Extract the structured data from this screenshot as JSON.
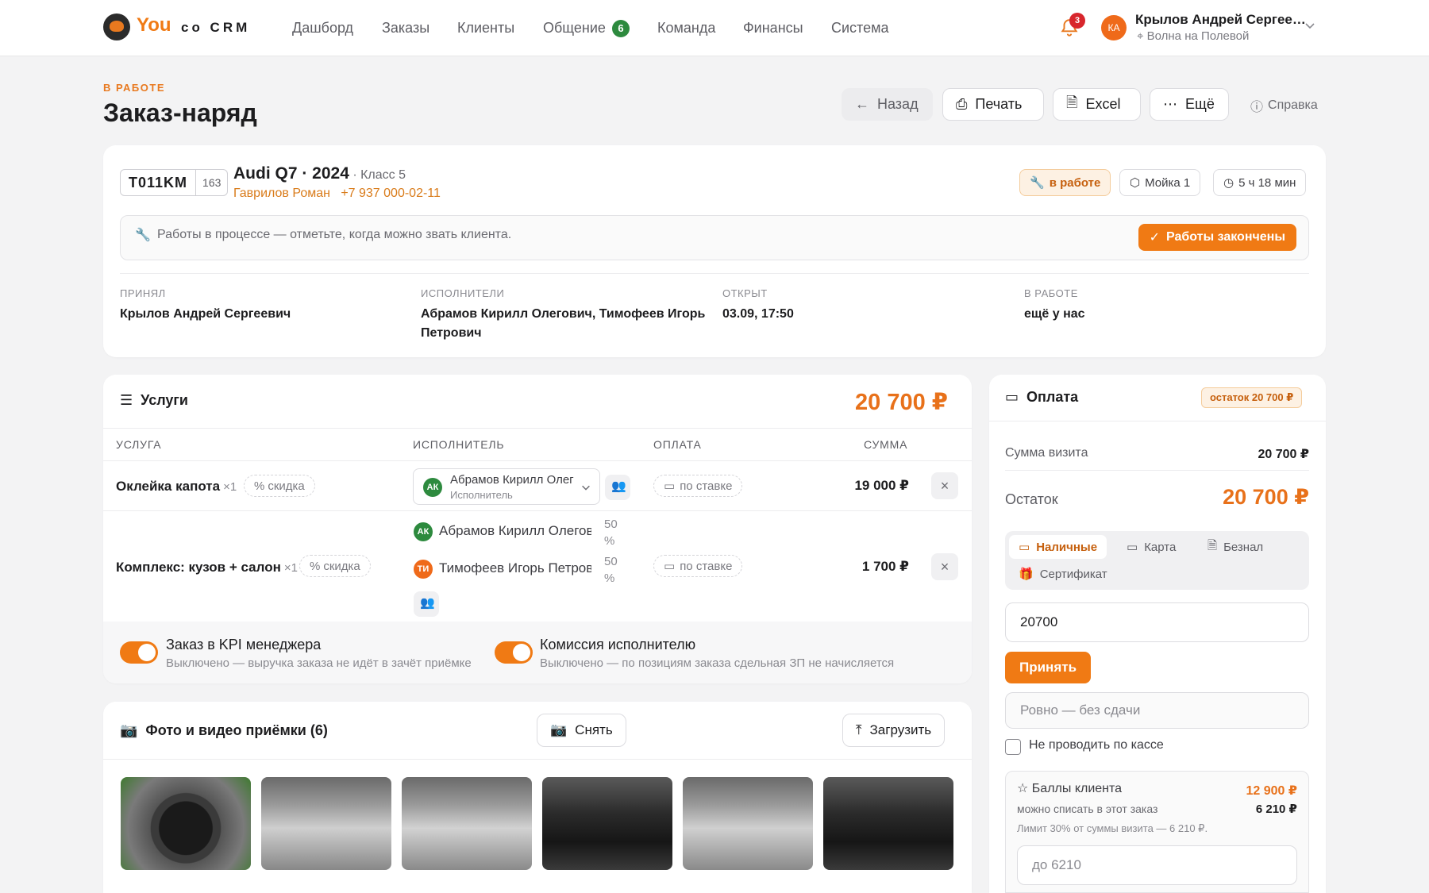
{
  "nav": {
    "logo_you": "You",
    "logo_crm": "co CRM",
    "items": [
      "Дашборд",
      "Заказы",
      "Клиенты",
      "Общение",
      "Команда",
      "Финансы",
      "Система"
    ],
    "chat_badge": "6",
    "notifications_count": "3",
    "user": {
      "initials": "КА",
      "name": "Крылов Андрей Сергее…",
      "location": "Волна на Полевой"
    }
  },
  "header": {
    "status": "В РАБОТЕ",
    "title": "Заказ-наряд",
    "buttons": {
      "back": "Назад",
      "print": "Печать",
      "excel": "Excel",
      "more": "Ещё"
    },
    "help": "Справка"
  },
  "vehicle": {
    "plate": "T011KM",
    "region": "163",
    "title": "Audi Q7 · 2024",
    "class": " · Класс 5",
    "owner": "Гаврилов Роман",
    "phone": "+7 937 000-02-11",
    "pills": {
      "status": "в работе",
      "wash": "Мойка 1",
      "time": "5 ч 18 мин"
    },
    "notice": "Работы в процессе — отметьте, когда можно звать клиента.",
    "done_button": "Работы закончены"
  },
  "meta": [
    {
      "label": "ПРИНЯЛ",
      "value": "Крылов Андрей Сергеевич"
    },
    {
      "label": "ИСПОЛНИТЕЛИ",
      "value": "Абрамов Кирилл Олегович, Тимофеев Игорь Петрович"
    },
    {
      "label": "ОТКРЫТ",
      "value": "03.09, 17:50"
    },
    {
      "label": "В РАБОТЕ",
      "value": "ещё у нас"
    }
  ],
  "services": {
    "title": "Услуги",
    "total": "20 700 ₽",
    "columns": [
      "УСЛУГА",
      "ИСПОЛНИТЕЛЬ",
      "ОПЛАТА",
      "СУММА"
    ],
    "discount_label": "скидка",
    "rate_label": "по ставке",
    "rows": [
      {
        "name": "Оклейка капота",
        "qty": "×1",
        "executor": {
          "initials": "АК",
          "name": "Абрамов Кирилл Олег",
          "role": "Исполнитель"
        },
        "amount": "19 000 ₽"
      },
      {
        "name": "Комплекс: кузов + салон",
        "qty": "×1",
        "executors": [
          {
            "initials": "АК",
            "name": "Абрамов Кирилл Олегови",
            "pct": "50",
            "pct_unit": "%"
          },
          {
            "initials": "ТИ",
            "name": "Тимофеев Игорь Петрови",
            "pct": "50",
            "pct_unit": "%"
          }
        ],
        "amount": "1 700 ₽"
      }
    ],
    "toggles": [
      {
        "title": "Заказ в KPI менеджера",
        "sub": "Выключено — выручка заказа не идёт в зачёт приёмке"
      },
      {
        "title": "Комиссия исполнителю",
        "sub": "Выключено — по позициям заказа сдельная ЗП не начисляется"
      }
    ]
  },
  "photos": {
    "title": "Фото и видео приёмки (6)",
    "shoot": "Снять",
    "upload": "Загрузить"
  },
  "payment": {
    "title": "Оплата",
    "rest_badge": "остаток 20 700 ₽",
    "visit_label": "Сумма визита",
    "visit_value": "20 700 ₽",
    "rest_label": "Остаток",
    "rest_value": "20 700 ₽",
    "tabs": [
      "Наличные",
      "Карта",
      "Безнал",
      "Сертификат"
    ],
    "amount_value": "20700",
    "accept": "Принять",
    "change_placeholder": "Ровно — без сдачи",
    "no_cashbox": "Не проводить по кассе",
    "bonus": {
      "title": "Баллы клиента",
      "balance": "12 900 ₽",
      "can_spend_label": "можно списать в этот заказ",
      "can_spend_value": "6 210 ₽",
      "limit": "Лимит 30% от суммы визита — 6 210 ₽.",
      "placeholder": "до 6210"
    }
  },
  "colors": {
    "accent": "#f07a14",
    "success": "#2d8a3e",
    "danger": "#d8262c"
  }
}
